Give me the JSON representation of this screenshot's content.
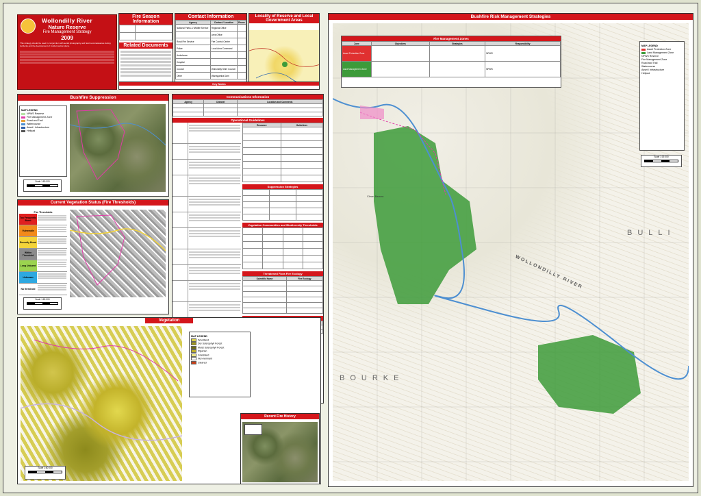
{
  "title_block": {
    "line1": "Wollondilly River",
    "line2": "Nature Reserve",
    "line3": "Fire Management Strategy",
    "year": "2009",
    "intro": "This strategy should be used in conjunction with aerial photography and field reconnaissance during incidents and the development of incident action plans."
  },
  "fire_season": {
    "title": "Fire Season Information"
  },
  "related_docs": {
    "title": "Related Documents"
  },
  "contact": {
    "title": "Contact Information",
    "headers": [
      "Agency",
      "Contact / Location",
      "Phone"
    ],
    "rows": [
      [
        "National Parks & Wildlife Service",
        "Regional Office",
        ""
      ],
      [
        "",
        "Area Office",
        ""
      ],
      [
        "Rural Fire Service",
        "Fire Control Centre",
        ""
      ],
      [
        "Police",
        "Local Area Command",
        ""
      ],
      [
        "Ambulance",
        "",
        ""
      ],
      [
        "Hospital",
        "",
        ""
      ],
      [
        "Council",
        "Wollondilly Shire Council",
        ""
      ],
      [
        "Other",
        "Warragamba Dam",
        ""
      ]
    ]
  },
  "locality": {
    "title": "Locality of Reserve and Local Government Areas"
  },
  "key_notes": {
    "title": "Key Notes"
  },
  "bushfire_suppression": {
    "title": "Bushfire Suppression"
  },
  "comms": {
    "title": "Communications Information",
    "headers": [
      "Agency",
      "Channel",
      "Location and Comments"
    ]
  },
  "operational": {
    "title": "Operational Guidelines"
  },
  "resource": {
    "headers": [
      "Resource",
      "Guidelines"
    ]
  },
  "suppression_strategies": {
    "title": "Suppression Strategies"
  },
  "veg_communities": {
    "title": "Vegetation Communities and Biodiversity Thresholds"
  },
  "threatened_flora": {
    "title": "Threatened Flora Fire Ecology",
    "headers": [
      "Scientific Name",
      "Fire Ecology"
    ]
  },
  "threatened_fauna": {
    "title": "Threatened Fauna Fire Ecology",
    "headers": [
      "Scientific Name",
      "Fire Ecology"
    ]
  },
  "current_veg": {
    "title": "Current Vegetation Status (Fire Thresholds)",
    "legend_title": "Fire Thresholds",
    "classes": [
      {
        "name": "Too Frequently Burnt",
        "color": "#e02020"
      },
      {
        "name": "Vulnerable",
        "color": "#f28a1a"
      },
      {
        "name": "Recently Burnt",
        "color": "#f4d43a"
      },
      {
        "name": "Within Threshold",
        "color": "#8c8c8c"
      },
      {
        "name": "Long Unburnt",
        "color": "#9bd34f"
      },
      {
        "name": "Unknown",
        "color": "#2fa8e0"
      },
      {
        "name": "No threshold",
        "color": "#ffffff"
      }
    ]
  },
  "vegetation": {
    "title": "Vegetation",
    "legend_title": "MAP LEGEND",
    "classes": [
      {
        "name": "Woodland",
        "color": "#d9cf4a"
      },
      {
        "name": "Dry Sclerophyll Forest",
        "color": "#a59c1d"
      },
      {
        "name": "Moist Sclerophyll Forest",
        "color": "#6e6c14"
      },
      {
        "name": "Riparian",
        "color": "#bfae2c"
      },
      {
        "name": "Grassland",
        "color": "#f0e98a"
      },
      {
        "name": "Non-remnant",
        "color": "#ffffff"
      },
      {
        "name": "Cleared",
        "color": "#c8401a"
      }
    ]
  },
  "recent_fire": {
    "title": "Recent Fire History"
  },
  "risk_map": {
    "title": "Bushfire Risk Management Strategies",
    "zones_title": "Fire Management Zones",
    "zone_headers": [
      "Zone",
      "Objectives",
      "Strategies",
      "Responsibility"
    ],
    "zones": [
      {
        "name": "Asset Protection Zone",
        "color": "#e03030",
        "responsibility": "NPWS"
      },
      {
        "name": "Land Management Zone",
        "color": "#3d9b3a",
        "responsibility": "NPWS"
      }
    ],
    "legend_title": "MAP LEGEND",
    "place_labels": [
      "WOLLONDILLY RIVER",
      "BULLI",
      "BOURKE",
      "Clean Barrow"
    ],
    "scale": "Scale 1:15 000"
  },
  "map_legend_left": {
    "title": "MAP LEGEND",
    "items": [
      "NPWS Reserve",
      "Fire Management Zone",
      "Road and Trail",
      "Watercourse",
      "Asset / Infrastructure",
      "Helipad"
    ]
  },
  "scales": {
    "left_top": "Scale 1:80 000",
    "left_mid": "Scale 1:80 000",
    "left_bottom": "Scale 1:80 000"
  },
  "colors": {
    "accent_red": "#d4161b",
    "reserve_green": "#3d9b3a",
    "track_pink": "#e23aa8"
  }
}
